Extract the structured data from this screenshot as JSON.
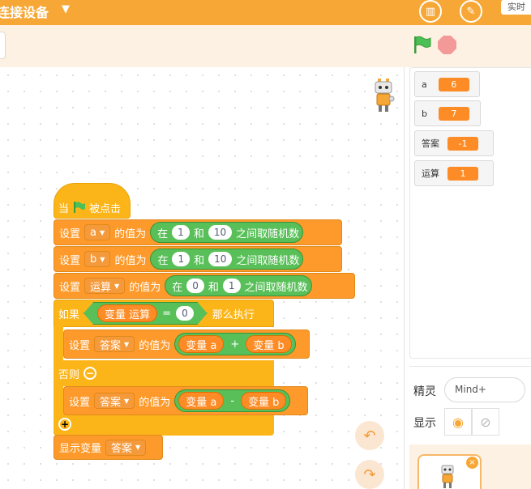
{
  "topbar": {
    "title": "连接设备",
    "caret": "▼",
    "realtime_label": "实时"
  },
  "code": {
    "hat": {
      "when": "当",
      "clicked": "被点击"
    },
    "set_a": {
      "set": "设置",
      "var": "a",
      "value_of": "的值为",
      "in": "在",
      "from": "1",
      "and": "和",
      "to": "10",
      "between": "之间取随机数"
    },
    "set_b": {
      "set": "设置",
      "var": "b",
      "value_of": "的值为",
      "in": "在",
      "from": "1",
      "and": "和",
      "to": "10",
      "between": "之间取随机数"
    },
    "set_op": {
      "set": "设置",
      "var": "运算",
      "value_of": "的值为",
      "in": "在",
      "from": "0",
      "and": "和",
      "to": "1",
      "between": "之间取随机数"
    },
    "if_block": {
      "if": "如果",
      "var_label": "变量 运算",
      "eq": "=",
      "value": "0",
      "then": "那么执行",
      "else": "否则"
    },
    "set_ans_add": {
      "set": "设置",
      "var": "答案",
      "value_of": "的值为",
      "left": "变量 a",
      "op": "+",
      "right": "变量 b"
    },
    "set_ans_sub": {
      "set": "设置",
      "var": "答案",
      "value_of": "的值为",
      "left": "变量 a",
      "op": "-",
      "right": "变量 b"
    },
    "show_var": {
      "label": "显示变量",
      "var": "答案"
    }
  },
  "monitors": [
    {
      "name": "a",
      "value": "6"
    },
    {
      "name": "b",
      "value": "7"
    },
    {
      "name": "答案",
      "value": "-1"
    },
    {
      "name": "运算",
      "value": "1"
    }
  ],
  "sprite": {
    "label_sprite": "精灵",
    "name": "Mind+",
    "label_show": "显示"
  }
}
